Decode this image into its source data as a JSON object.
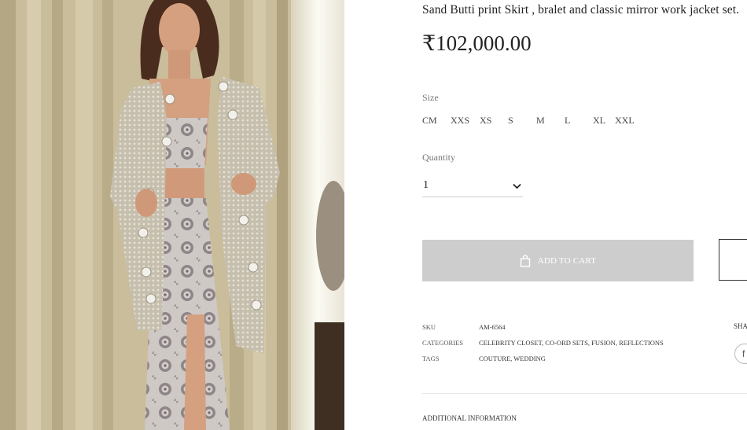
{
  "product": {
    "title": "Sand Butti print Skirt , bralet and classic mirror work jacket set.",
    "price": "₹102,000.00",
    "image_alt": "Model wearing printed skirt, bralet and mirror work jacket"
  },
  "size": {
    "label": "Size",
    "options": [
      "CM",
      "XXS",
      "XS",
      "S",
      "M",
      "L",
      "XL",
      "XXL"
    ]
  },
  "quantity": {
    "label": "Quantity",
    "value": "1"
  },
  "cart": {
    "add_label": "ADD TO CART"
  },
  "meta": {
    "sku_label": "SKU",
    "sku_value": "AM-6564",
    "categories_label": "CATEGORIES",
    "categories": [
      "CELEBRITY CLOSET",
      "CO-ORD SETS",
      "FUSION",
      "REFLECTIONS"
    ],
    "tags_label": "TAGS",
    "tags": [
      "COUTURE",
      "WEDDING"
    ]
  },
  "share": {
    "label": "SHA",
    "facebook_glyph": "f"
  },
  "additional_info_label": "ADDITIONAL INFORMATION",
  "colors": {
    "button_disabled": "#cdcdcd",
    "text_primary": "#222222",
    "text_muted": "#777777"
  }
}
